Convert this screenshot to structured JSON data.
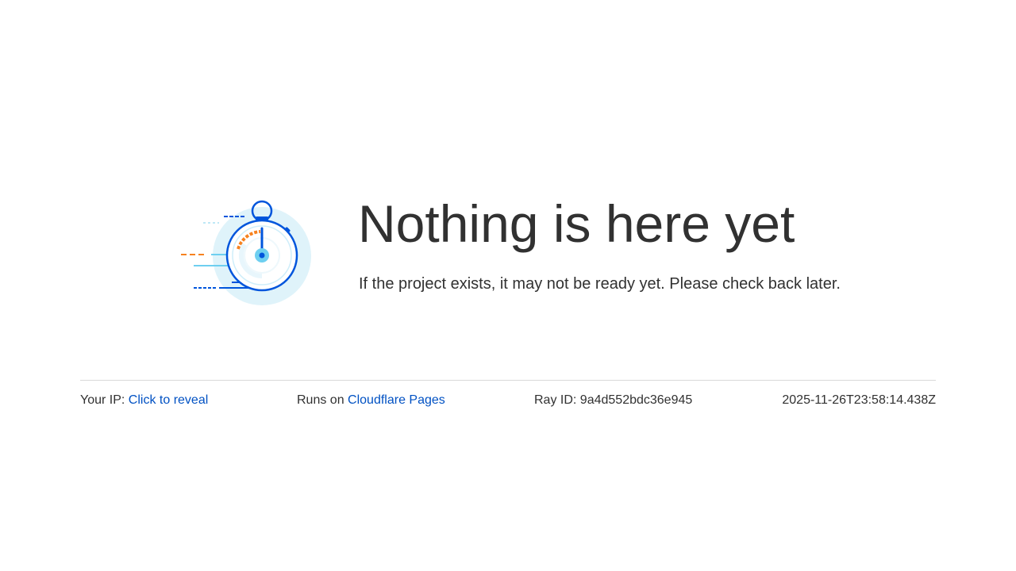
{
  "main": {
    "illustration_icon": "stopwatch-speed-icon",
    "title": "Nothing is here yet",
    "subtitle": "If the project exists, it may not be ready yet. Please check back later."
  },
  "footer": {
    "ip_label": "Your IP:",
    "ip_link": "Click to reveal",
    "runs_label": "Runs on",
    "runs_link": "Cloudflare Pages",
    "ray_label": "Ray ID:",
    "ray_value": "9a4d552bdc36e945",
    "timestamp": "2025-11-26T23:58:14.438Z"
  },
  "colors": {
    "text": "#313131",
    "link": "#0051c3",
    "accent_blue": "#0055dc",
    "light_blue": "#dff3fa",
    "orange": "#f6821f",
    "divider": "#d9d9d9"
  }
}
